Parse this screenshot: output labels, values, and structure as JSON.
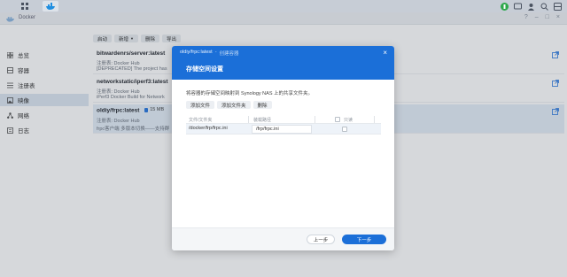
{
  "app": {
    "title": "Docker"
  },
  "sidebar": {
    "items": [
      {
        "label": "总览",
        "icon": "grid-icon"
      },
      {
        "label": "容器",
        "icon": "container-icon"
      },
      {
        "label": "注册表",
        "icon": "registry-icon"
      },
      {
        "label": "映像",
        "icon": "image-icon"
      },
      {
        "label": "网络",
        "icon": "network-icon"
      },
      {
        "label": "日志",
        "icon": "log-icon"
      }
    ]
  },
  "toolbar": {
    "start": "启动",
    "new": "新增",
    "delete": "删除",
    "export": "导出"
  },
  "images": [
    {
      "name": "bitwardenrs/server:latest",
      "registry": "注册表: Docker Hub",
      "desc": "[DEPRECATED] The project has"
    },
    {
      "name": "networkstatic/iperf3:latest",
      "registry": "注册表: Docker Hub",
      "desc": "iPerf3 Docker Build for Network"
    },
    {
      "name": "oldiy/frpc:latest",
      "size": "15 MB",
      "registry": "注册表: Docker Hub",
      "desc": "frpc客户端 多版本切换——支持群"
    }
  ],
  "dialog": {
    "crumb_main": "oldiy/frpc:latest",
    "crumb_sep": "-",
    "crumb_sub": "创建容器",
    "title": "存储空间设置",
    "description": "将容器的存储空间映射到 Synology NAS 上的共享文件夹。",
    "add_file": "添加文件",
    "add_folder": "添加文件夹",
    "delete": "删除",
    "columns": {
      "file_folder": "文件/文件夹",
      "mount_path": "装载路径",
      "readonly": "只读"
    },
    "rows": [
      {
        "file": "/docker/frp/frpc.ini",
        "mount": "/frp/frpc.ini"
      }
    ],
    "prev": "上一步",
    "next": "下一步"
  },
  "colors": {
    "accent": "#1b6fd8",
    "selected_row": "#e4eef8",
    "taskbar": "#c7cdd6"
  }
}
